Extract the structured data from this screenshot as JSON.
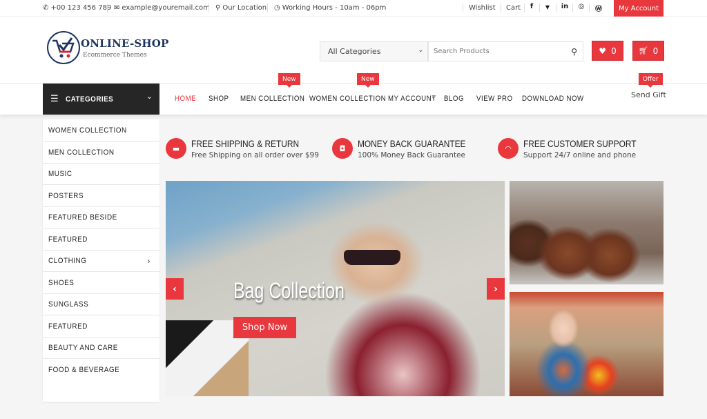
{
  "topbar": {
    "phone": "+00 123 456 789",
    "email": "example@youremail.com",
    "location": "Our Location",
    "hours": "Working Hours - 10am - 06pm",
    "wishlist": "Wishlist",
    "cart": "Cart",
    "social": [
      {
        "icon": "facebook-icon",
        "glyph": "f"
      },
      {
        "icon": "twitter-icon",
        "glyph": "🐦"
      },
      {
        "icon": "linkedin-icon",
        "glyph": "in"
      },
      {
        "icon": "instagram-icon",
        "glyph": "◎"
      },
      {
        "icon": "wordpress-icon",
        "glyph": "Ⓦ"
      }
    ],
    "my_account": "My Account"
  },
  "header": {
    "logo_title": "ONLINE-SHOP",
    "logo_subtitle": "Ecommerce  Themes",
    "category_select": "All Categories",
    "search_placeholder": "Search Products",
    "wishlist_count": "0",
    "cart_count": "0"
  },
  "nav": {
    "categories_label": "CATEGORIES",
    "links": [
      {
        "label": "HOME",
        "active": true
      },
      {
        "label": "SHOP"
      },
      {
        "label": "MEN COLLECTION",
        "badge": "New"
      },
      {
        "label": "WOMEN COLLECTION",
        "badge": "New"
      },
      {
        "label": "MY ACCOUNT",
        "dropdown": true
      },
      {
        "label": "BLOG"
      },
      {
        "label": "VIEW PRO"
      },
      {
        "label": "DOWNLOAD NOW"
      }
    ],
    "send_gift": "Send Gift",
    "send_gift_badge": "Offer"
  },
  "sidebar": {
    "items": [
      {
        "label": "WOMEN COLLECTION"
      },
      {
        "label": "MEN COLLECTION"
      },
      {
        "label": "MUSIC"
      },
      {
        "label": "POSTERS"
      },
      {
        "label": "FEATURED BESIDE"
      },
      {
        "label": "FEATURED"
      },
      {
        "label": "CLOTHING",
        "has_submenu": true
      },
      {
        "label": "SHOES"
      },
      {
        "label": "SUNGLASS"
      },
      {
        "label": "FEATURED"
      },
      {
        "label": "BEAUTY AND CARE"
      },
      {
        "label": "FOOD & BEVERAGE"
      }
    ]
  },
  "features": [
    {
      "icon": "truck-icon",
      "title": "FREE SHIPPING & RETURN",
      "subtitle": "Free Shipping on all order over $99"
    },
    {
      "icon": "money-icon",
      "title": "MONEY BACK GUARANTEE",
      "subtitle": "100% Money Back Guarantee"
    },
    {
      "icon": "headset-icon",
      "title": "FREE CUSTOMER SUPPORT",
      "subtitle": "Support 24/7 online and phone"
    }
  ],
  "hero": {
    "title": "Bag Collection",
    "cta": "Shop Now",
    "prev": "‹",
    "next": "›"
  },
  "colors": {
    "accent": "#e8383d",
    "dark": "#262626",
    "brand": "#1e3560"
  }
}
